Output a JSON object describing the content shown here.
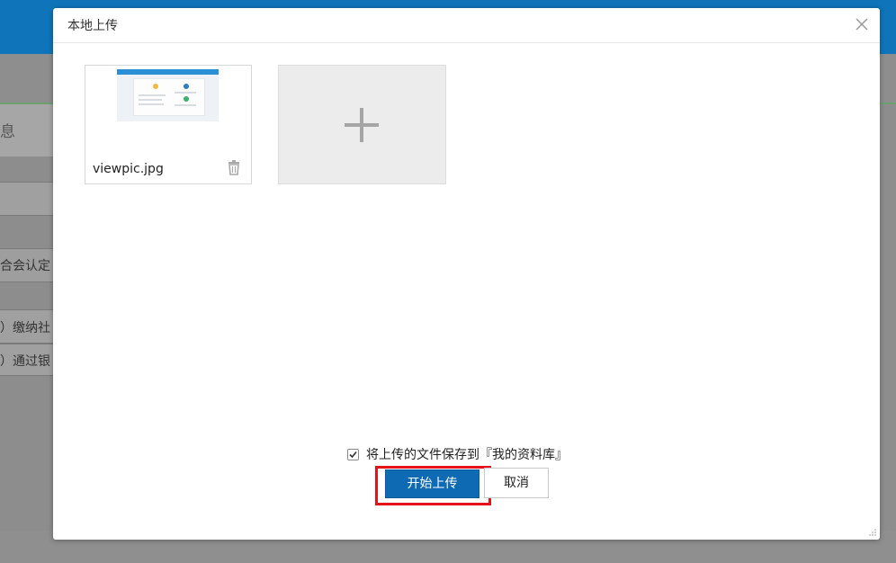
{
  "background": {
    "tab_label": "息",
    "rows": [
      "合会认定",
      "）缴纳社",
      "）通过银"
    ]
  },
  "dialog": {
    "title": "本地上传",
    "files": [
      {
        "name": "viewpic.jpg"
      }
    ],
    "save_option_label": "将上传的文件保存到『我的资料库』",
    "save_option_checked": true,
    "upload_button": "开始上传",
    "cancel_button": "取消"
  },
  "colors": {
    "topbar": "#0f74b9",
    "primary_button": "#0f6ab4",
    "highlight": "#e5121c"
  },
  "icons": {
    "close": "close-icon",
    "delete": "trash-icon",
    "add": "plus-icon",
    "check": "checkmark-icon"
  }
}
